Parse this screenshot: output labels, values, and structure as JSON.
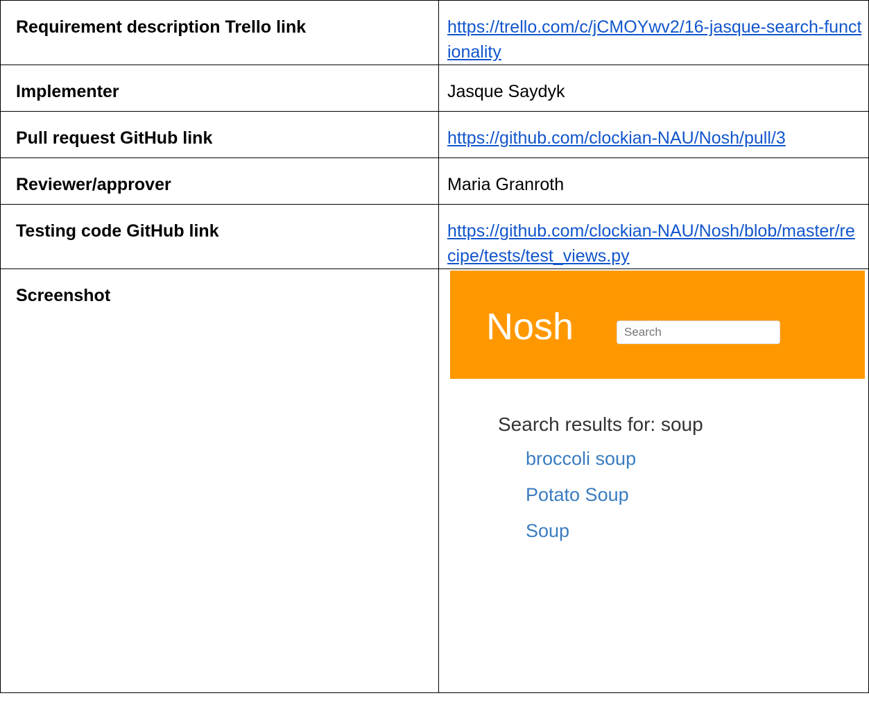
{
  "rows": [
    {
      "label": "Requirement description Trello link",
      "value": "https://trello.com/c/jCMOYwv2/16-jasque-search-functionality"
    },
    {
      "label": "Implementer",
      "value": "Jasque Saydyk"
    },
    {
      "label": "Pull request GitHub link",
      "value": "https://github.com/clockian-NAU/Nosh/pull/3"
    },
    {
      "label": "Reviewer/approver",
      "value": "Maria Granroth"
    },
    {
      "label": "Testing code GitHub link",
      "value": "https://github.com/clockian-NAU/Nosh/blob/master/recipe/tests/test_views.py"
    },
    {
      "label": "Screenshot"
    }
  ],
  "screenshot": {
    "logo": "Nosh",
    "search_placeholder": "Search",
    "results_heading": "Search results for: soup",
    "results": [
      "broccoli soup",
      "Potato Soup",
      "Soup"
    ],
    "colors": {
      "header_bg": "#ff9800",
      "link": "#3a7cc0"
    }
  },
  "colors": {
    "link": "#1155cc"
  }
}
